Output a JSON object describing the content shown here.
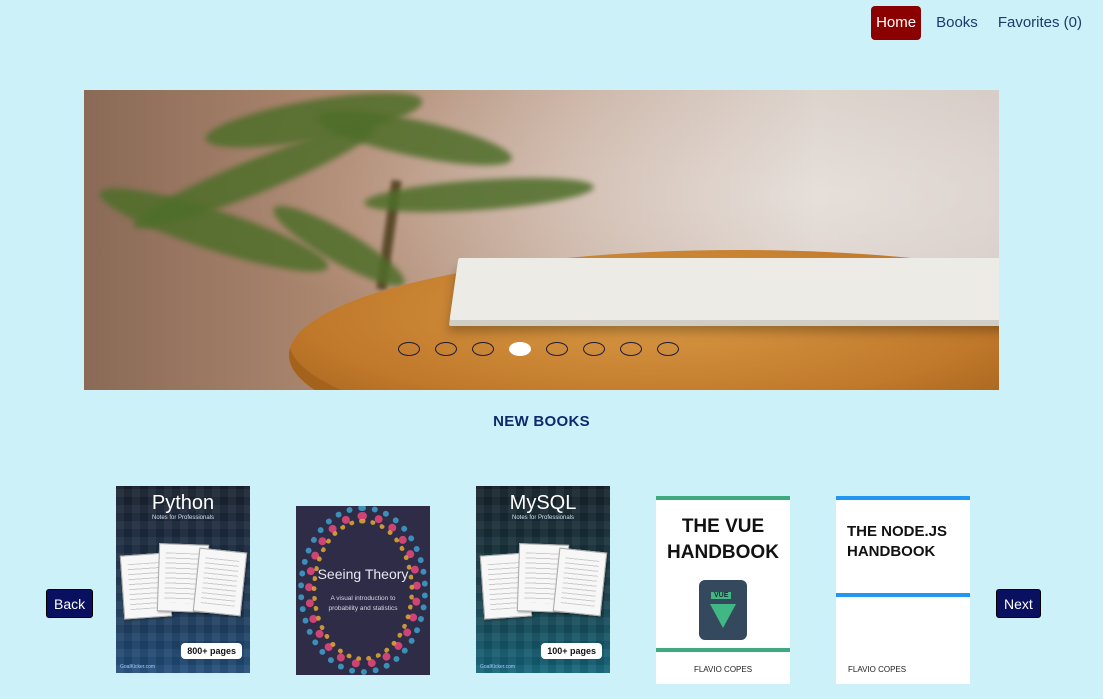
{
  "nav": {
    "items": [
      {
        "label": "Home",
        "active": true
      },
      {
        "label": "Books",
        "active": false
      },
      {
        "label": "Favorites (0)",
        "active": false
      }
    ]
  },
  "hero": {
    "slide_count": 8,
    "active_slide": 4
  },
  "section": {
    "title": "NEW BOOKS"
  },
  "carousel": {
    "back_label": "Back",
    "next_label": "Next",
    "books": [
      {
        "cover_title": "Python",
        "cover_subtitle": "Notes for Professionals",
        "badge": "800+ pages",
        "footer": "GoalKicker.com"
      },
      {
        "cover_title": "Seeing Theory",
        "cover_subtitle": "A visual introduction to probability and statistics"
      },
      {
        "cover_title": "MySQL",
        "cover_subtitle": "Notes for Professionals",
        "badge": "100+ pages",
        "footer": "GoalKicker.com"
      },
      {
        "cover_title": "THE VUE HANDBOOK",
        "author": "FLAVIO COPES",
        "logo_text": "VUE"
      },
      {
        "cover_title": "THE NODE.JS HANDBOOK",
        "author": "FLAVIO COPES"
      }
    ]
  },
  "colors": {
    "background": "#ccf1f8",
    "nav_active": "#8b0000",
    "button": "#0a1060",
    "title": "#0f2a6b"
  }
}
